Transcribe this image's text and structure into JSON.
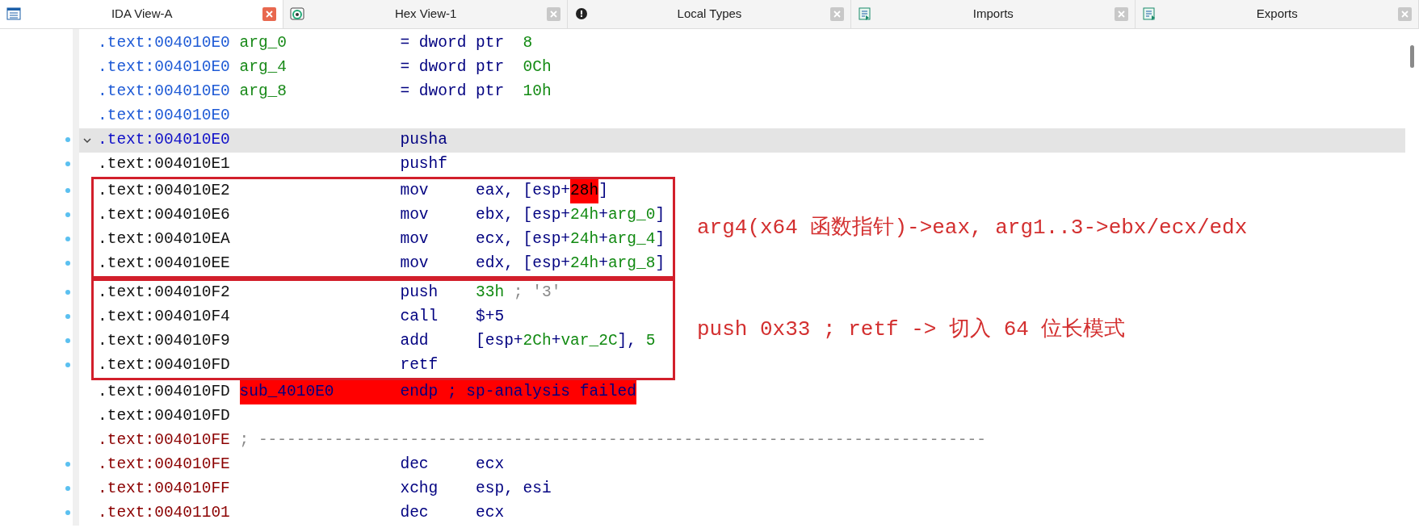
{
  "tabs": [
    {
      "title": "IDA View-A",
      "selected": true
    },
    {
      "title": "Hex View-1",
      "selected": false
    },
    {
      "title": "Local Types",
      "selected": false
    },
    {
      "title": "Imports",
      "selected": false
    },
    {
      "title": "Exports",
      "selected": false
    }
  ],
  "listing": [
    {
      "kind": "data",
      "address": ".text:004010E0",
      "color": "#1f5bd6",
      "marked": false,
      "selected": false,
      "label": "arg_0",
      "mnemonic": "= dword ptr",
      "operands": [
        {
          "text": "8",
          "kind": "number"
        }
      ]
    },
    {
      "kind": "data",
      "address": ".text:004010E0",
      "color": "#1f5bd6",
      "marked": false,
      "selected": false,
      "label": "arg_4",
      "mnemonic": "= dword ptr",
      "operands": [
        {
          "text": "0Ch",
          "kind": "number"
        }
      ]
    },
    {
      "kind": "data",
      "address": ".text:004010E0",
      "color": "#1f5bd6",
      "marked": false,
      "selected": false,
      "label": "arg_8",
      "mnemonic": "= dword ptr",
      "operands": [
        {
          "text": "10h",
          "kind": "number"
        }
      ]
    },
    {
      "kind": "blank",
      "address": ".text:004010E0",
      "color": "#1f5bd6",
      "marked": false,
      "selected": false
    },
    {
      "kind": "instruction",
      "address": ".text:004010E0",
      "color": "#1010c8",
      "marked": true,
      "selected": true,
      "expanded": true,
      "mnemonic": "pusha"
    },
    {
      "kind": "instruction",
      "address": ".text:004010E1",
      "color": "#111111",
      "marked": true,
      "selected": false,
      "mnemonic": "pushf"
    },
    {
      "kind": "box",
      "note": "arg4(x64 函数指针)->eax, arg1..3->ebx/ecx/edx",
      "lines": [
        {
          "kind": "instruction",
          "address": ".text:004010E2",
          "color": "#111111",
          "marked": true,
          "selected": false,
          "mnemonic": "mov",
          "operands": [
            {
              "text": "eax, [esp+",
              "kind": "plain"
            },
            {
              "text": "28h",
              "kind": "highlight"
            },
            {
              "text": "]",
              "kind": "plain"
            }
          ]
        },
        {
          "kind": "instruction",
          "address": ".text:004010E6",
          "color": "#111111",
          "marked": true,
          "selected": false,
          "mnemonic": "mov",
          "operands": [
            {
              "text": "ebx, [esp+",
              "kind": "plain"
            },
            {
              "text": "24h",
              "kind": "number"
            },
            {
              "text": "+",
              "kind": "plain"
            },
            {
              "text": "arg_0",
              "kind": "name"
            },
            {
              "text": "]",
              "kind": "plain"
            }
          ]
        },
        {
          "kind": "instruction",
          "address": ".text:004010EA",
          "color": "#111111",
          "marked": true,
          "selected": false,
          "mnemonic": "mov",
          "operands": [
            {
              "text": "ecx, [esp+",
              "kind": "plain"
            },
            {
              "text": "24h",
              "kind": "number"
            },
            {
              "text": "+",
              "kind": "plain"
            },
            {
              "text": "arg_4",
              "kind": "name"
            },
            {
              "text": "]",
              "kind": "plain"
            }
          ]
        },
        {
          "kind": "instruction",
          "address": ".text:004010EE",
          "color": "#111111",
          "marked": true,
          "selected": false,
          "mnemonic": "mov",
          "operands": [
            {
              "text": "edx, [esp+",
              "kind": "plain"
            },
            {
              "text": "24h",
              "kind": "number"
            },
            {
              "text": "+",
              "kind": "plain"
            },
            {
              "text": "arg_8",
              "kind": "name"
            },
            {
              "text": "]",
              "kind": "plain"
            }
          ]
        }
      ]
    },
    {
      "kind": "box",
      "note": "push 0x33 ; retf -> 切入 64 位长模式",
      "lines": [
        {
          "kind": "instruction",
          "address": ".text:004010F2",
          "color": "#111111",
          "marked": true,
          "selected": false,
          "mnemonic": "push",
          "operands": [
            {
              "text": "33h",
              "kind": "number"
            },
            {
              "text": "; '3'",
              "kind": "comment"
            }
          ]
        },
        {
          "kind": "instruction",
          "address": ".text:004010F4",
          "color": "#111111",
          "marked": true,
          "selected": false,
          "mnemonic": "call",
          "operands": [
            {
              "text": "$+5",
              "kind": "plain"
            }
          ]
        },
        {
          "kind": "instruction",
          "address": ".text:004010F9",
          "color": "#111111",
          "marked": true,
          "selected": false,
          "mnemonic": "add",
          "operands": [
            {
              "text": "[esp+",
              "kind": "plain"
            },
            {
              "text": "2Ch",
              "kind": "number"
            },
            {
              "text": "+",
              "kind": "plain"
            },
            {
              "text": "var_2C",
              "kind": "name"
            },
            {
              "text": "], ",
              "kind": "plain"
            },
            {
              "text": "5",
              "kind": "number"
            }
          ]
        },
        {
          "kind": "instruction",
          "address": ".text:004010FD",
          "color": "#111111",
          "marked": true,
          "selected": false,
          "mnemonic": "retf"
        }
      ]
    },
    {
      "kind": "endp",
      "address": ".text:004010FD",
      "color": "#111111",
      "marked": false,
      "selected": false,
      "error": true,
      "label": "sub_4010E0",
      "mnemonic": "endp",
      "operands": [
        {
          "text": "; sp-analysis failed",
          "kind": "plain"
        }
      ]
    },
    {
      "kind": "blank",
      "address": ".text:004010FD",
      "color": "#111111",
      "marked": false,
      "selected": false
    },
    {
      "kind": "separator",
      "address": ".text:004010FE",
      "color": "#8b0000",
      "marked": false,
      "selected": false,
      "operands": [
        {
          "text": "; -----------------------------------------------------------------------------",
          "kind": "comment"
        }
      ]
    },
    {
      "kind": "instruction",
      "address": ".text:004010FE",
      "color": "#8b0000",
      "marked": true,
      "selected": false,
      "mnemonic": "dec",
      "operands": [
        {
          "text": "ecx",
          "kind": "plain"
        }
      ]
    },
    {
      "kind": "instruction",
      "address": ".text:004010FF",
      "color": "#8b0000",
      "marked": true,
      "selected": false,
      "mnemonic": "xchg",
      "operands": [
        {
          "text": "esp, esi",
          "kind": "plain"
        }
      ]
    },
    {
      "kind": "instruction",
      "address": ".text:00401101",
      "color": "#8b0000",
      "marked": true,
      "selected": false,
      "mnemonic": "dec",
      "operands": [
        {
          "text": "ecx",
          "kind": "plain"
        }
      ]
    }
  ]
}
